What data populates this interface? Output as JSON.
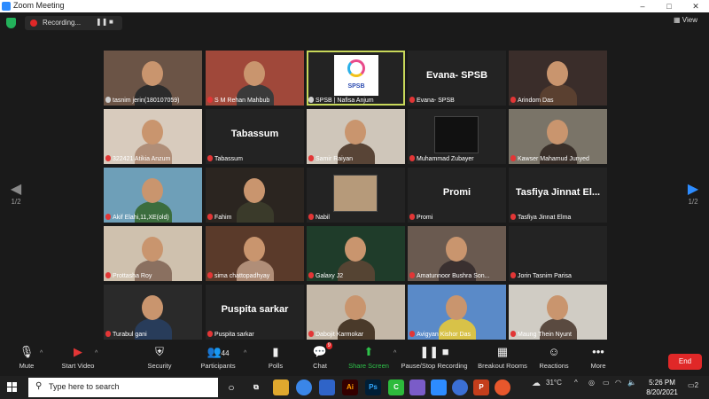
{
  "window": {
    "title": "Zoom Meeting",
    "buttons": [
      "–",
      "□",
      "✕"
    ]
  },
  "recording": {
    "label": "Recording...",
    "pause_icon": "pause-icon",
    "stop_icon": "stop-icon"
  },
  "view": {
    "label": "View"
  },
  "pager": {
    "left_label": "1/2",
    "right_label": "1/2"
  },
  "participants": [
    {
      "label": "tasnim jerin(180107059)",
      "muted": false,
      "type": "video"
    },
    {
      "label": "S M Rehan Mahbub",
      "muted": true,
      "type": "video"
    },
    {
      "label": "SPSB | Nafisa Anjum",
      "muted": false,
      "type": "logo",
      "speaking": true,
      "logo_text": "SPSB"
    },
    {
      "label": "Evana- SPSB",
      "muted": true,
      "type": "name",
      "bigname": "Evana- SPSB"
    },
    {
      "label": "Arindom Das",
      "muted": true,
      "type": "video"
    },
    {
      "label": "322421 Atikia Anzum",
      "muted": true,
      "type": "video"
    },
    {
      "label": "Tabassum",
      "muted": true,
      "type": "name",
      "bigname": "Tabassum"
    },
    {
      "label": "Samir Raiyan",
      "muted": true,
      "type": "video"
    },
    {
      "label": "Muhammad Zubayer",
      "muted": true,
      "type": "image"
    },
    {
      "label": "Kawser Mahamud Junyed",
      "muted": true,
      "type": "video"
    },
    {
      "label": "Akif Elahi,11,XE(old)",
      "muted": true,
      "type": "video"
    },
    {
      "label": "Fahim",
      "muted": true,
      "type": "video"
    },
    {
      "label": "Nabil",
      "muted": true,
      "type": "image"
    },
    {
      "label": "Promi",
      "muted": true,
      "type": "name",
      "bigname": "Promi"
    },
    {
      "label": "Tasfiya Jinnat Elma",
      "muted": true,
      "type": "name",
      "bigname": "Tasfiya Jinnat El..."
    },
    {
      "label": "Prottasha Roy",
      "muted": true,
      "type": "video"
    },
    {
      "label": "sima chattopadhyay",
      "muted": true,
      "type": "video"
    },
    {
      "label": "Galaxy J2",
      "muted": true,
      "type": "video"
    },
    {
      "label": "Amatunnoor Bushra Son...",
      "muted": true,
      "type": "video"
    },
    {
      "label": "Jorin Tasnim Parisa",
      "muted": true,
      "type": "blank"
    },
    {
      "label": "Turabul gani",
      "muted": true,
      "type": "video"
    },
    {
      "label": "Puspita sarkar",
      "muted": true,
      "type": "name",
      "bigname": "Puspita sarkar"
    },
    {
      "label": "Dabojit Karmokar",
      "muted": true,
      "type": "video"
    },
    {
      "label": "Avigyan Kishor Das",
      "muted": true,
      "type": "video"
    },
    {
      "label": "Maung Thein Nyunt",
      "muted": true,
      "type": "video"
    }
  ],
  "controls": {
    "mute": "Mute",
    "start_video": "Start Video",
    "security": "Security",
    "participants": "Participants",
    "participants_count": "44",
    "polls": "Polls",
    "chat": "Chat",
    "chat_badge": "9",
    "share_screen": "Share Screen",
    "pause_stop_recording": "Pause/Stop Recording",
    "breakout_rooms": "Breakout Rooms",
    "reactions": "Reactions",
    "more": "More",
    "end": "End"
  },
  "taskbar": {
    "search_placeholder": "Type here to search",
    "weather": "31°C",
    "time": "5:26 PM",
    "date": "8/20/2021",
    "notifications": "2",
    "apps": [
      "Ai",
      "Ps",
      "C",
      "W",
      "P"
    ]
  },
  "colors": {
    "accent_blue": "#2d8cff",
    "share_green": "#2ec24a",
    "end_red": "#e02828",
    "speaker_outline": "#c8d85a"
  }
}
